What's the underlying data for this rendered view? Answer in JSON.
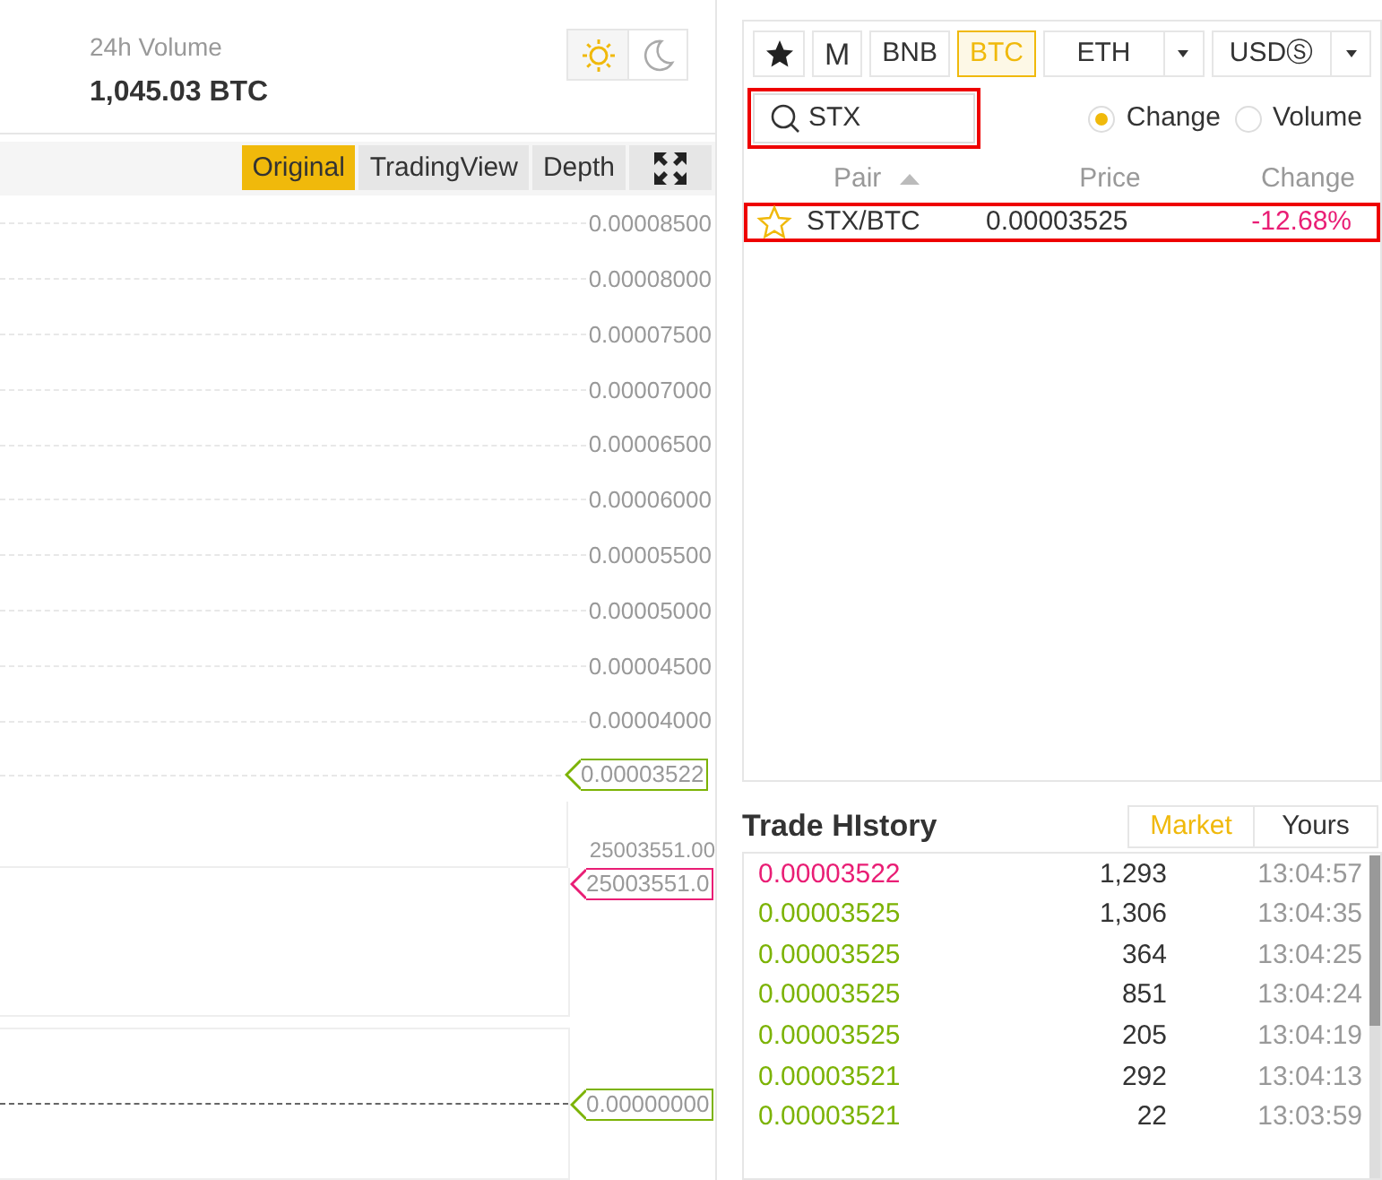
{
  "volume": {
    "label": "24h Volume",
    "value": "1,045.03 BTC"
  },
  "theme_toggle": [
    {
      "kind": "sun",
      "selected": true
    },
    {
      "kind": "moon",
      "selected": false
    }
  ],
  "chart_tabs": [
    {
      "label": "Original",
      "selected": true
    },
    {
      "label": "TradingView",
      "selected": false
    },
    {
      "label": "Depth",
      "selected": false
    }
  ],
  "price_axis": [
    "0.00008500",
    "0.00008000",
    "0.00007500",
    "0.00007000",
    "0.00006500",
    "0.00006000",
    "0.00005500",
    "0.00005000",
    "0.00004500",
    "0.00004000"
  ],
  "price_tag": {
    "text": "0.00003522",
    "color": "#7cb305"
  },
  "volume_axis_label": "25003551.00",
  "volume_tag": {
    "text": "25003551.0",
    "color": "#e91e75"
  },
  "indicator_tag": {
    "text": "0.00000000",
    "color": "#7cb305"
  },
  "market_tabs": [
    {
      "kind": "star",
      "selected": false
    },
    {
      "label": "M",
      "selected": false
    },
    {
      "label": "BNB",
      "selected": false
    },
    {
      "label": "BTC",
      "selected": true
    },
    {
      "label": "ETH",
      "selected": false,
      "dropdown": true
    },
    {
      "label": "USDⓈ",
      "selected": false,
      "dropdown": true
    }
  ],
  "search": {
    "value": "STX"
  },
  "sort_options": [
    {
      "label": "Change",
      "selected": true
    },
    {
      "label": "Volume",
      "selected": false
    }
  ],
  "pairs_table": {
    "columns": [
      "Pair",
      "Price",
      "Change"
    ],
    "rows": [
      {
        "favorite": false,
        "pair": "STX/BTC",
        "price": "0.00003525",
        "change": "-12.68%",
        "color": "#e91e75"
      }
    ]
  },
  "trade_history": {
    "title": "Trade HIstory",
    "tabs": [
      {
        "label": "Market",
        "selected": true
      },
      {
        "label": "Yours",
        "selected": false
      }
    ],
    "rows": [
      {
        "price": "0.00003522",
        "amount": "1,293",
        "time": "13:04:57",
        "color": "#e91e75"
      },
      {
        "price": "0.00003525",
        "amount": "1,306",
        "time": "13:04:35",
        "color": "#7cb305"
      },
      {
        "price": "0.00003525",
        "amount": "364",
        "time": "13:04:25",
        "color": "#7cb305"
      },
      {
        "price": "0.00003525",
        "amount": "851",
        "time": "13:04:24",
        "color": "#7cb305"
      },
      {
        "price": "0.00003525",
        "amount": "205",
        "time": "13:04:19",
        "color": "#7cb305"
      },
      {
        "price": "0.00003521",
        "amount": "292",
        "time": "13:04:13",
        "color": "#7cb305"
      },
      {
        "price": "0.00003521",
        "amount": "22",
        "time": "13:03:59",
        "color": "#7cb305"
      }
    ]
  }
}
